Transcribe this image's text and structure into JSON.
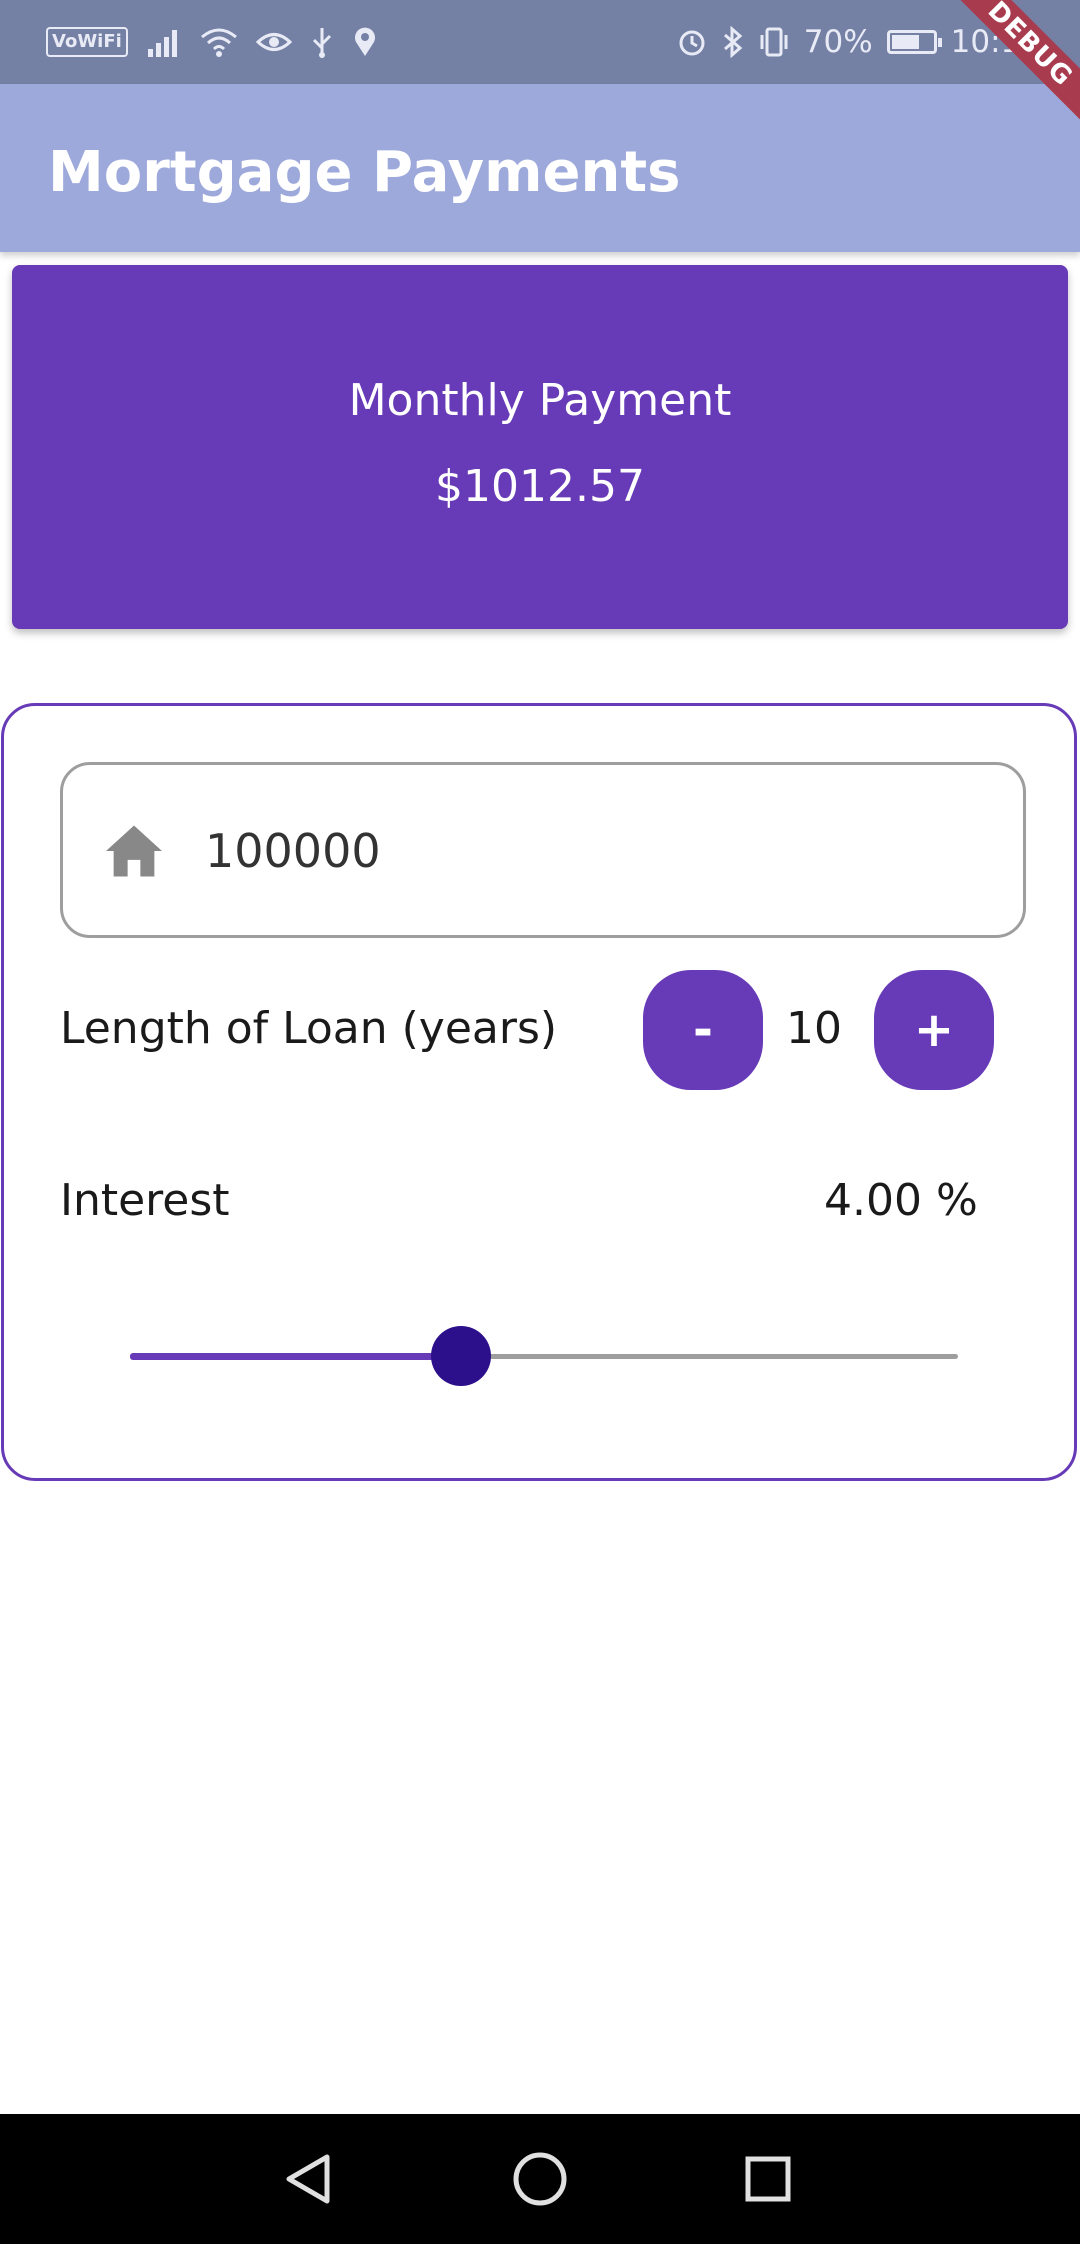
{
  "status_bar": {
    "vowifi": "VoWiFi",
    "battery_percent": "70%",
    "battery_level": 0.7,
    "time": "10:14",
    "icons": [
      "signal-icon",
      "wifi-icon",
      "eye-icon",
      "usb-icon",
      "location-icon",
      "alarm-icon",
      "bluetooth-icon",
      "vibrate-icon",
      "battery-icon"
    ]
  },
  "debug_banner": "DEBUG",
  "app_bar": {
    "title": "Mortgage Payments"
  },
  "payment": {
    "label": "Monthly Payment",
    "value": "$1012.57"
  },
  "form": {
    "amount": {
      "value": "100000",
      "icon": "home-icon"
    },
    "loan_length": {
      "label": "Length of Loan (years)",
      "decrement_label": "-",
      "increment_label": "+",
      "value": "10"
    },
    "interest": {
      "label": "Interest",
      "value_text": "4.00 %",
      "slider_fraction": 0.4
    }
  },
  "nav_bar": {
    "icons": [
      "back-icon",
      "home-circle-icon",
      "recents-icon"
    ]
  },
  "colors": {
    "primary": "#673ab7",
    "app_bar": "#9da9db",
    "status_bar": "#7580a5",
    "slider_thumb": "#2c0f8a"
  }
}
